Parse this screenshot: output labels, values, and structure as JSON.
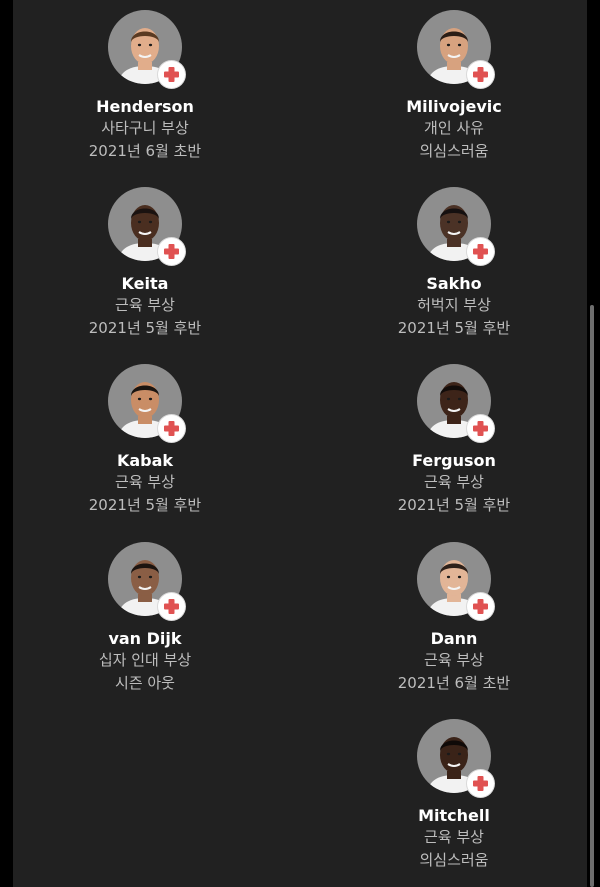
{
  "players": [
    {
      "name": "Henderson",
      "injury": "사타구니 부상",
      "return": "2021년 6월 초반",
      "skin": "#e1ad8b",
      "hair": "#5a3a22"
    },
    {
      "name": "Milivojevic",
      "injury": "개인 사유",
      "return": "의심스러움",
      "skin": "#d7a27f",
      "hair": "#2a1d16"
    },
    {
      "name": "Keita",
      "injury": "근육 부상",
      "return": "2021년 5월 후반",
      "skin": "#4a2e20",
      "hair": "#1a1210"
    },
    {
      "name": "Sakho",
      "injury": "허벅지 부상",
      "return": "2021년 5월 후반",
      "skin": "#4b3226",
      "hair": "#151010"
    },
    {
      "name": "Kabak",
      "injury": "근육 부상",
      "return": "2021년 5월 후반",
      "skin": "#c98d66",
      "hair": "#1a1410"
    },
    {
      "name": "Ferguson",
      "injury": "근육 부상",
      "return": "2021년 5월 후반",
      "skin": "#3d2419",
      "hair": "#120c0a"
    },
    {
      "name": "van Dijk",
      "injury": "십자 인대 부상",
      "return": "시즌 아웃",
      "skin": "#8a5e45",
      "hair": "#1c1410"
    },
    {
      "name": "Dann",
      "injury": "근육 부상",
      "return": "2021년 6월 초반",
      "skin": "#e2b597",
      "hair": "#2d2019"
    },
    {
      "name": "Mitchell",
      "injury": "근육 부상",
      "return": "의심스러움",
      "skin": "#3a2318",
      "hair": "#0f0a08"
    }
  ],
  "colors": {
    "background": "#212121",
    "name_text": "#ffffff",
    "info_text": "#bdbdbd",
    "badge_cross": "#e05252"
  },
  "icons": {
    "injury_badge": "red-cross-icon"
  }
}
